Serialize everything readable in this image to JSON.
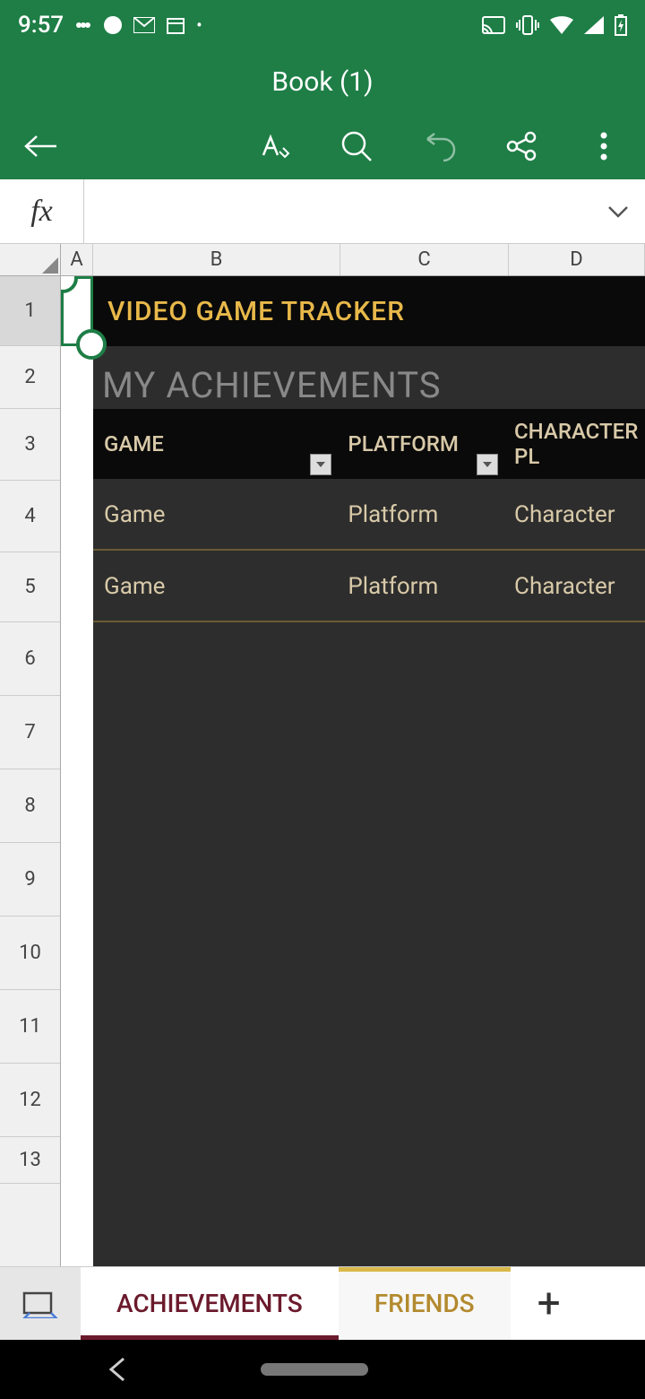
{
  "status": {
    "time": "9:57"
  },
  "header": {
    "title": "Book (1)"
  },
  "formula": {
    "fx": "fx",
    "value": ""
  },
  "columns": [
    "A",
    "B",
    "C",
    "D"
  ],
  "rows": [
    "1",
    "2",
    "3",
    "4",
    "5",
    "6",
    "7",
    "8",
    "9",
    "10",
    "11",
    "12",
    "13"
  ],
  "content": {
    "doc_title": "VIDEO GAME TRACKER",
    "section_title": "MY ACHIEVEMENTS",
    "table_headers": {
      "game": "GAME",
      "platform": "PLATFORM",
      "character": "CHARACTER PL"
    },
    "data_rows": [
      {
        "game": "Game",
        "platform": "Platform",
        "character": "Character"
      },
      {
        "game": "Game",
        "platform": "Platform",
        "character": "Character"
      }
    ]
  },
  "tabs": {
    "active": "ACHIEVEMENTS",
    "inactive": "FRIENDS",
    "add": "+"
  }
}
